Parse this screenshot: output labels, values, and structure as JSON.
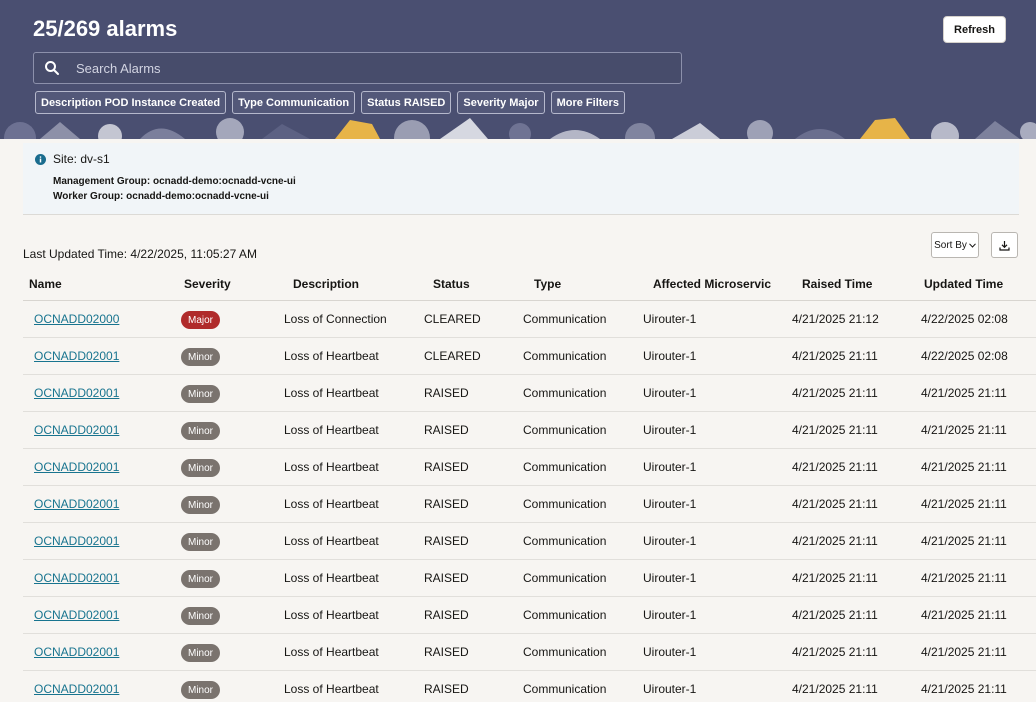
{
  "header": {
    "title": "25/269 alarms",
    "refresh_label": "Refresh",
    "search_placeholder": "Search Alarms",
    "filters": [
      "Description POD Instance Created",
      "Type Communication",
      "Status RAISED",
      "Severity Major",
      "More Filters"
    ]
  },
  "site": {
    "name": "Site: dv-s1",
    "management_group": "Management Group: ocnadd-demo:ocnadd-vcne-ui",
    "worker_group": "Worker Group: ocnadd-demo:ocnadd-vcne-ui"
  },
  "toolbar": {
    "last_updated": "Last Updated Time: 4/22/2025, 11:05:27 AM",
    "sort_label": "Sort By"
  },
  "table": {
    "columns": [
      "Name",
      "Severity",
      "Description",
      "Status",
      "Type",
      "Affected Microservic",
      "Raised Time",
      "Updated Time"
    ],
    "rows": [
      {
        "name": "OCNADD02000",
        "severity": "Major",
        "description": "Loss of Connection",
        "status": "CLEARED",
        "type": "Communication",
        "microservice": "Uirouter-1",
        "raised": "4/21/2025 21:12",
        "updated": "4/22/2025 02:08"
      },
      {
        "name": "OCNADD02001",
        "severity": "Minor",
        "description": "Loss of Heartbeat",
        "status": "CLEARED",
        "type": "Communication",
        "microservice": "Uirouter-1",
        "raised": "4/21/2025 21:11",
        "updated": "4/22/2025 02:08"
      },
      {
        "name": "OCNADD02001",
        "severity": "Minor",
        "description": "Loss of Heartbeat",
        "status": "RAISED",
        "type": "Communication",
        "microservice": "Uirouter-1",
        "raised": "4/21/2025 21:11",
        "updated": "4/21/2025 21:11"
      },
      {
        "name": "OCNADD02001",
        "severity": "Minor",
        "description": "Loss of Heartbeat",
        "status": "RAISED",
        "type": "Communication",
        "microservice": "Uirouter-1",
        "raised": "4/21/2025 21:11",
        "updated": "4/21/2025 21:11"
      },
      {
        "name": "OCNADD02001",
        "severity": "Minor",
        "description": "Loss of Heartbeat",
        "status": "RAISED",
        "type": "Communication",
        "microservice": "Uirouter-1",
        "raised": "4/21/2025 21:11",
        "updated": "4/21/2025 21:11"
      },
      {
        "name": "OCNADD02001",
        "severity": "Minor",
        "description": "Loss of Heartbeat",
        "status": "RAISED",
        "type": "Communication",
        "microservice": "Uirouter-1",
        "raised": "4/21/2025 21:11",
        "updated": "4/21/2025 21:11"
      },
      {
        "name": "OCNADD02001",
        "severity": "Minor",
        "description": "Loss of Heartbeat",
        "status": "RAISED",
        "type": "Communication",
        "microservice": "Uirouter-1",
        "raised": "4/21/2025 21:11",
        "updated": "4/21/2025 21:11"
      },
      {
        "name": "OCNADD02001",
        "severity": "Minor",
        "description": "Loss of Heartbeat",
        "status": "RAISED",
        "type": "Communication",
        "microservice": "Uirouter-1",
        "raised": "4/21/2025 21:11",
        "updated": "4/21/2025 21:11"
      },
      {
        "name": "OCNADD02001",
        "severity": "Minor",
        "description": "Loss of Heartbeat",
        "status": "RAISED",
        "type": "Communication",
        "microservice": "Uirouter-1",
        "raised": "4/21/2025 21:11",
        "updated": "4/21/2025 21:11"
      },
      {
        "name": "OCNADD02001",
        "severity": "Minor",
        "description": "Loss of Heartbeat",
        "status": "RAISED",
        "type": "Communication",
        "microservice": "Uirouter-1",
        "raised": "4/21/2025 21:11",
        "updated": "4/21/2025 21:11"
      },
      {
        "name": "OCNADD02001",
        "severity": "Minor",
        "description": "Loss of Heartbeat",
        "status": "RAISED",
        "type": "Communication",
        "microservice": "Uirouter-1",
        "raised": "4/21/2025 21:11",
        "updated": "4/21/2025 21:11"
      }
    ]
  },
  "colors": {
    "header_bg": "#4a4f71",
    "major": "#b02b2b",
    "minor": "#7a736e",
    "link": "#18748f"
  }
}
